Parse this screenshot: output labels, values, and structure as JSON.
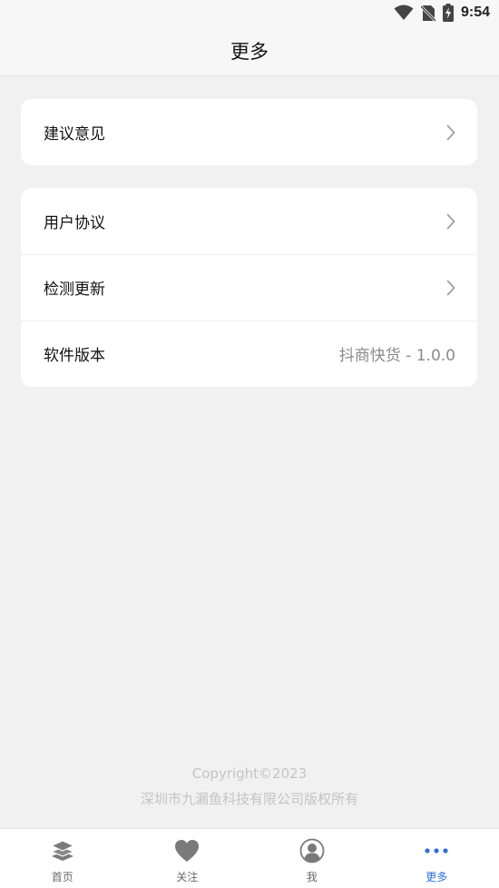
{
  "status_bar": {
    "time": "9:54"
  },
  "header": {
    "title": "更多"
  },
  "card1": {
    "items": [
      {
        "label": "建议意见"
      }
    ]
  },
  "card2": {
    "items": [
      {
        "label": "用户协议"
      },
      {
        "label": "检测更新"
      },
      {
        "label": "软件版本",
        "value": "抖商快货 - 1.0.0"
      }
    ]
  },
  "footer": {
    "copyright": "Copyright©2023",
    "company": "深圳市九漏鱼科技有限公司版权所有"
  },
  "tabbar": {
    "active_color": "#2f6fd9",
    "items": [
      {
        "label": "首页",
        "icon": "layers-icon"
      },
      {
        "label": "关注",
        "icon": "heart-icon"
      },
      {
        "label": "我",
        "icon": "user-icon"
      },
      {
        "label": "更多",
        "icon": "more-dots-icon"
      }
    ]
  }
}
